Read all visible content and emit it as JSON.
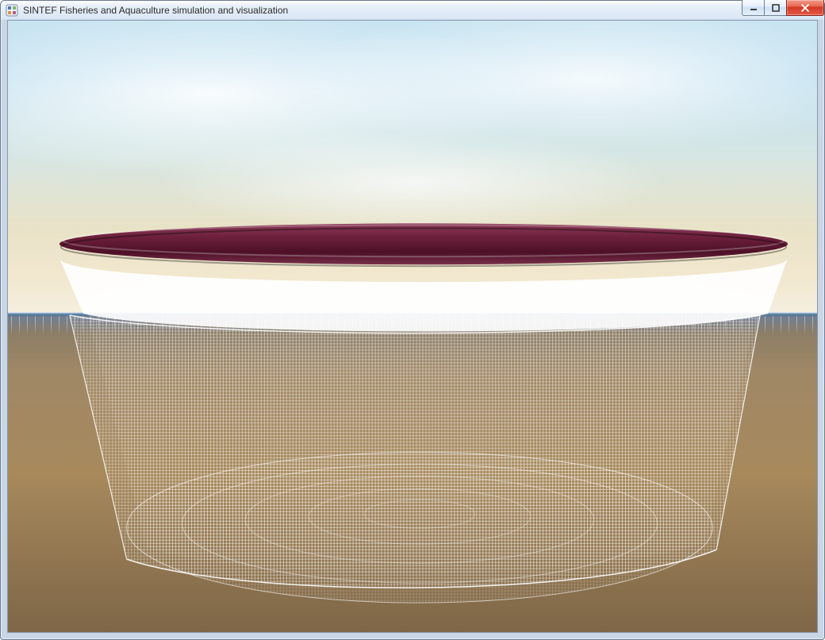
{
  "window": {
    "title": "SINTEF Fisheries and Aquaculture simulation and visualization",
    "icon": "app-icon",
    "buttons": {
      "minimize": "Minimize",
      "maximize": "Maximize",
      "close": "Close"
    }
  },
  "scene": {
    "description": "3D aquaculture net-cage simulation viewport",
    "object": "net-cage",
    "wireframe": true,
    "float_ring_color": "#6b1f3b",
    "net_color": "#ffffff",
    "sky_top": "#c8e4f1",
    "sky_horizon": "#f2e8cf",
    "seabed_near": "#a08866",
    "seabed_far": "#7e6647",
    "waterline_color": "#4f7393"
  }
}
